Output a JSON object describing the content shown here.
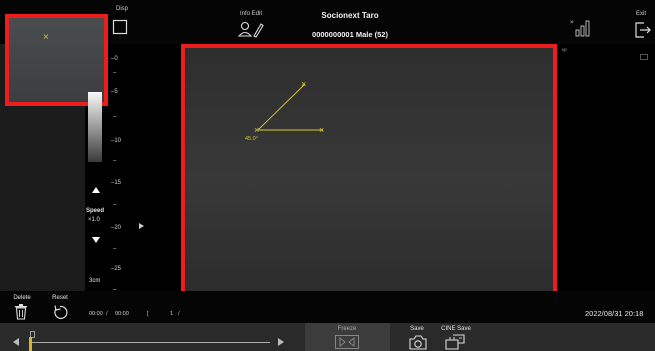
{
  "topbar": {
    "disp_label": "Disp",
    "info_edit_label": "Info Edit",
    "patient_name": "Socionext Taro",
    "patient_id": "0000000001 Male (52)",
    "exit_label": "Exit"
  },
  "thumbnail": {
    "marker": "×"
  },
  "depth_scale": {
    "ticks": [
      "0",
      "5",
      "10",
      "15",
      "20",
      "25"
    ],
    "unit": "3cm"
  },
  "speed": {
    "label": "Speed",
    "value": "×1.0"
  },
  "measurement": {
    "angle_label": "45.0°"
  },
  "bottom": {
    "delete_label": "Delete",
    "reset_label": "Reset",
    "elapsed": "00:00",
    "total": "00:00",
    "frame": "1",
    "datetime": "2022/08/31 20:18",
    "freeze_label": "Freeze",
    "save_label": "Save",
    "cine_save_label": "CINE Save"
  },
  "colors": {
    "highlight": "#ee1d1d",
    "caliper": "#d9c832"
  }
}
